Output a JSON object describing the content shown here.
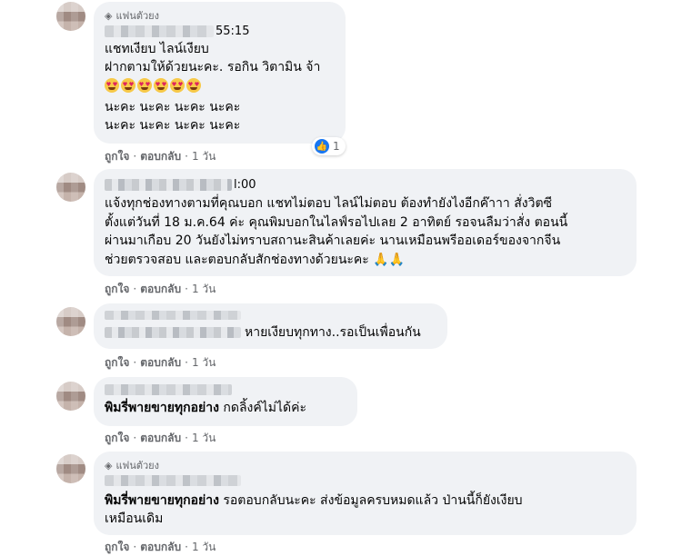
{
  "comments": [
    {
      "badge": "แฟนตัวยง",
      "time_suffix": "55:15",
      "lines": [
        "แชทเงียบ ไลน์เงียบ",
        "ฝากตามให้ด้วยนะคะ. รอกิน วิตามิน จ้า",
        "",
        "นะคะ นะคะ นะคะ นะคะ",
        "นะคะ นะคะ นะคะ นะคะ"
      ],
      "emoji_count": 6,
      "reaction_count": "1",
      "actions": {
        "like": "ถูกใจ",
        "reply": "ตอบกลับ",
        "time": "1 วัน"
      }
    },
    {
      "time_suffix": "l:00",
      "lines": [
        "แจ้งทุกช่องทางตามที่คุณบอก แชทไม่ตอบ ไลน์ไม่ตอบ ต้องทำยังไงอีกค๊าาา สั่งวิตซี",
        "ตั้งแต่วันที่ 18 ม.ค.64 ค่ะ คุณพิมบอกในไลฟ์รอไปเลย 2 อาทิตย์ รอจนลืมว่าสั่ง ตอนนี้",
        "ผ่านมาเกือบ 20 วันยังไม่ทราบสถานะสินค้าเลยค่ะ นานเหมือนพรีออเดอร์ของจากจีน",
        "ช่วยตรวจสอบ และตอบกลับสักช่องทางด้วยนะคะ"
      ],
      "actions": {
        "like": "ถูกใจ",
        "reply": "ตอบกลับ",
        "time": "1 วัน"
      }
    },
    {
      "text": "หายเงียบทุกทาง..รอเป็นเพื่อนกัน",
      "actions": {
        "like": "ถูกใจ",
        "reply": "ตอบกลับ",
        "time": "1 วัน"
      }
    },
    {
      "tag": "พิมรี่พายขายทุกอย่าง",
      "text": "กดลิ้งค์ไม่ได้ค่ะ",
      "actions": {
        "like": "ถูกใจ",
        "reply": "ตอบกลับ",
        "time": "1 วัน"
      }
    },
    {
      "badge": "แฟนตัวยง",
      "tag": "พิมรี่พายขายทุกอย่าง",
      "text": "รอตอบกลับนะคะ ส่งข้อมูลครบหมดแล้ว ป่านนี้ก็ยังเงียบ",
      "text2": "เหมือนเดิม",
      "actions": {
        "like": "ถูกใจ",
        "reply": "ตอบกลับ",
        "time": "1 วัน"
      }
    }
  ],
  "separator": "·"
}
